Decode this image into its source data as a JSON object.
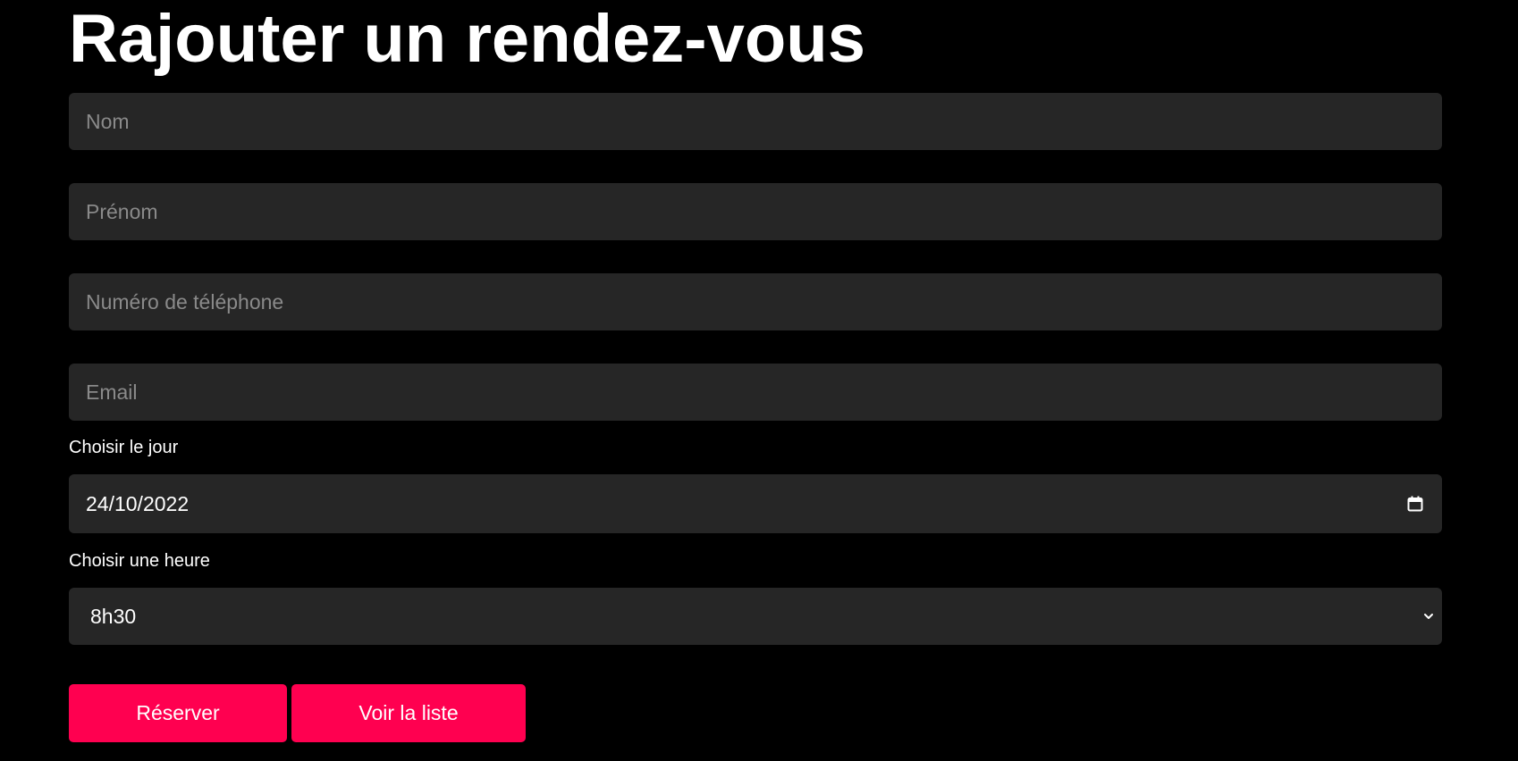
{
  "page": {
    "title": "Rajouter un rendez-vous"
  },
  "form": {
    "nom": {
      "placeholder": "Nom",
      "value": ""
    },
    "prenom": {
      "placeholder": "Prénom",
      "value": ""
    },
    "telephone": {
      "placeholder": "Numéro de téléphone",
      "value": ""
    },
    "email": {
      "placeholder": "Email",
      "value": ""
    },
    "jour": {
      "label": "Choisir le jour",
      "value": "24/10/2022",
      "icon": "calendar-icon"
    },
    "heure": {
      "label": "Choisir une heure",
      "selected": "8h30",
      "icon": "chevron-down-icon"
    }
  },
  "actions": {
    "reserver_label": "Réserver",
    "liste_label": "Voir la liste"
  },
  "colors": {
    "background": "#000000",
    "field_background": "#262626",
    "accent": "#ff0050",
    "placeholder": "#8a8a8a",
    "text": "#ffffff"
  }
}
